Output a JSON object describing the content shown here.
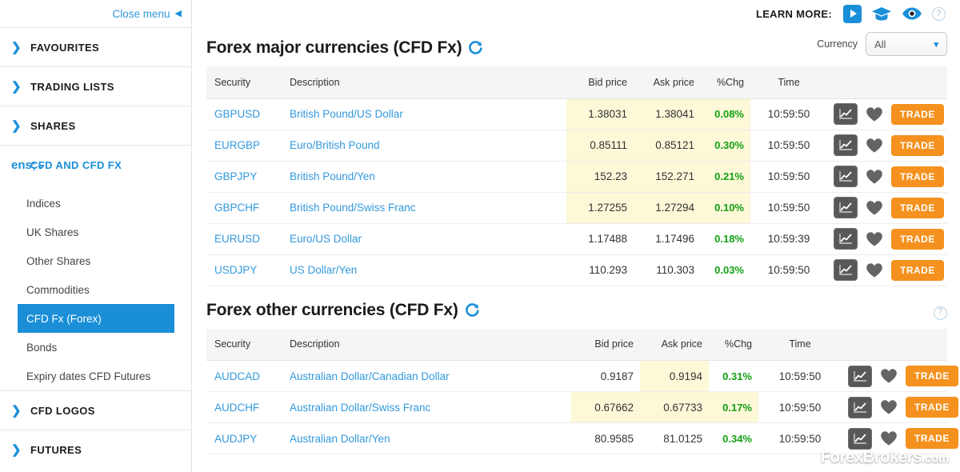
{
  "sidebar": {
    "close_menu": "Close menu",
    "groups": [
      {
        "label": "FAVOURITES",
        "state": "collapsed"
      },
      {
        "label": "TRADING LISTS",
        "state": "collapsed"
      },
      {
        "label": "SHARES",
        "state": "collapsed"
      },
      {
        "label": "CFD AND CFD FX",
        "state": "expanded"
      }
    ],
    "sub_items": [
      {
        "label": "Indices",
        "active": false
      },
      {
        "label": "UK Shares",
        "active": false
      },
      {
        "label": "Other Shares",
        "active": false
      },
      {
        "label": "Commodities",
        "active": false
      },
      {
        "label": "CFD Fx (Forex)",
        "active": true
      },
      {
        "label": "Bonds",
        "active": false
      },
      {
        "label": "Expiry dates CFD Futures",
        "active": false
      }
    ],
    "groups_bottom": [
      {
        "label": "CFD LOGOS",
        "state": "collapsed"
      },
      {
        "label": "FUTURES",
        "state": "collapsed"
      }
    ]
  },
  "header": {
    "learn_more_label": "LEARN MORE:",
    "icons": [
      "play-icon",
      "graduation-cap-icon",
      "eye-icon",
      "help-icon"
    ]
  },
  "section1": {
    "title": "Forex major currencies (CFD Fx)",
    "refresh_icon": "refresh-icon",
    "currency_label": "Currency",
    "currency_value": "All",
    "columns": [
      "Security",
      "Description",
      "Bid price",
      "Ask price",
      "%Chg",
      "Time",
      ""
    ],
    "rows": [
      {
        "security": "GBPUSD",
        "description": "British Pound/US Dollar",
        "bid": "1.38031",
        "ask": "1.38041",
        "chg": "0.08%",
        "time": "10:59:50",
        "highlight": "all",
        "trade": "TRADE"
      },
      {
        "security": "EURGBP",
        "description": "Euro/British Pound",
        "bid": "0.85111",
        "ask": "0.85121",
        "chg": "0.30%",
        "time": "10:59:50",
        "highlight": "all",
        "trade": "TRADE"
      },
      {
        "security": "GBPJPY",
        "description": "British Pound/Yen",
        "bid": "152.23",
        "ask": "152.271",
        "chg": "0.21%",
        "time": "10:59:50",
        "highlight": "all",
        "trade": "TRADE"
      },
      {
        "security": "GBPCHF",
        "description": "British Pound/Swiss Franc",
        "bid": "1.27255",
        "ask": "1.27294",
        "chg": "0.10%",
        "time": "10:59:50",
        "highlight": "all",
        "trade": "TRADE"
      },
      {
        "security": "EURUSD",
        "description": "Euro/US Dollar",
        "bid": "1.17488",
        "ask": "1.17496",
        "chg": "0.18%",
        "time": "10:59:39",
        "highlight": "none",
        "trade": "TRADE"
      },
      {
        "security": "USDJPY",
        "description": "US Dollar/Yen",
        "bid": "110.293",
        "ask": "110.303",
        "chg": "0.03%",
        "time": "10:59:50",
        "highlight": "none",
        "trade": "TRADE"
      }
    ]
  },
  "section2": {
    "title": "Forex other currencies (CFD Fx)",
    "refresh_icon": "refresh-icon",
    "help_icon": "help-icon",
    "columns": [
      "Security",
      "Description",
      "Bid price",
      "Ask price",
      "%Chg",
      "Time",
      ""
    ],
    "rows": [
      {
        "security": "AUDCAD",
        "description": "Australian Dollar/Canadian Dollar",
        "bid": "0.9187",
        "ask": "0.9194",
        "chg": "0.31%",
        "time": "10:59:50",
        "highlight": "ask",
        "trade": "TRADE"
      },
      {
        "security": "AUDCHF",
        "description": "Australian Dollar/Swiss Franc",
        "bid": "0.67662",
        "ask": "0.67733",
        "chg": "0.17%",
        "time": "10:59:50",
        "highlight": "all",
        "trade": "TRADE"
      },
      {
        "security": "AUDJPY",
        "description": "Australian Dollar/Yen",
        "bid": "80.9585",
        "ask": "81.0125",
        "chg": "0.34%",
        "time": "10:59:50",
        "highlight": "none",
        "trade": "TRADE"
      }
    ]
  },
  "watermark": {
    "text": "ForexBrokers",
    "suffix": ".com"
  },
  "colors": {
    "accent_blue": "#1a8fd8",
    "link_blue": "#3399dd",
    "up_green": "#13a013",
    "trade_orange": "#f5911e",
    "highlight_yellow": "#fcf8d8",
    "header_grey": "#f5f5f5"
  }
}
